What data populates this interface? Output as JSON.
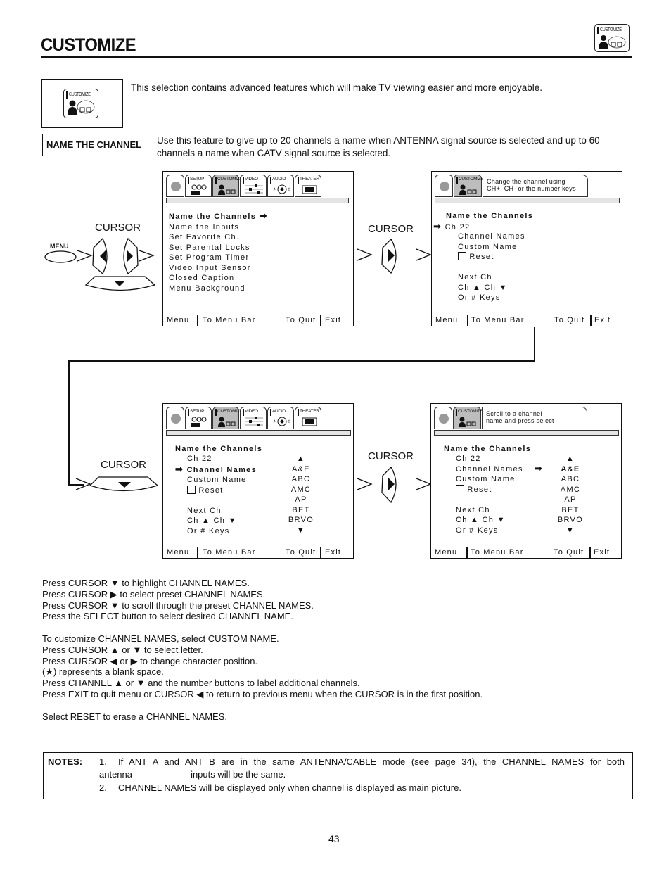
{
  "header": {
    "title": "CUSTOMIZE",
    "icon_label": "CUSTOMIZE"
  },
  "intro": {
    "icon_label": "CUSTOMIZE",
    "text": "This selection contains advanced features which will make TV viewing easier and more enjoyable."
  },
  "feature": {
    "label": "NAME THE CHANNEL",
    "text": "Use this feature to give up to 20 channels a name when ANTENNA signal source is selected and up to 60 channels a name when CATV signal source is selected."
  },
  "controls": {
    "menu_label": "MENU",
    "cursor_label": "CURSOR"
  },
  "menu_tabs": [
    "SETUP",
    "CUSTOMIZE",
    "VIDEO",
    "AUDIO",
    "THEATER"
  ],
  "footer": {
    "menu": "Menu",
    "to_menu_bar": "To Menu Bar",
    "to_quit": "To Quit",
    "exit": "Exit"
  },
  "screen1": {
    "items": [
      "Name the Channels",
      "Name the Inputs",
      "Set Favorite Ch.",
      "Set Parental Locks",
      "Set Program Timer",
      "Video Input Sensor",
      "Closed Caption",
      "Menu Background"
    ]
  },
  "screen2": {
    "help": [
      "Change the channel using",
      "CH+, CH- or the number keys"
    ],
    "title": "Name the Channels",
    "items": [
      "Ch 22",
      "Channel Names",
      "Custom Name",
      "Reset",
      "Next Ch",
      "Ch ▲ Ch ▼",
      "Or # Keys"
    ]
  },
  "screen3": {
    "title": "Name the Channels",
    "items": [
      "Ch 22",
      "Channel Names",
      "Custom Name",
      "Reset",
      "Next Ch",
      "Ch ▲ Ch ▼",
      "Or # Keys"
    ],
    "names": [
      "▲",
      "A&E",
      "ABC",
      "AMC",
      "AP",
      "BET",
      "BRVO",
      "▼"
    ]
  },
  "screen4": {
    "help": [
      "Scroll to a channel",
      "name and press select"
    ],
    "title": "Name the Channels",
    "items": [
      "Ch 22",
      "Channel Names",
      "Custom Name",
      "Reset",
      "Next Ch",
      "Ch ▲ Ch ▼",
      "Or # Keys"
    ],
    "names": [
      "▲",
      "A&E",
      "ABC",
      "AMC",
      "AP",
      "BET",
      "BRVO",
      "▼"
    ]
  },
  "instructions": [
    "Press CURSOR  ▼ to highlight CHANNEL NAMES.",
    "Press CURSOR ▶ to select preset CHANNEL NAMES.",
    "Press CURSOR ▼ to scroll through the preset CHANNEL NAMES.",
    "Press the SELECT button to select desired CHANNEL NAME.",
    "",
    "To customize CHANNEL NAMES, select CUSTOM NAME.",
    "Press CURSOR ▲ or ▼ to select letter.",
    "Press CURSOR ◀ or ▶ to change character position.",
    "(★) represents a blank space.",
    "Press CHANNEL ▲ or ▼  and the number buttons to label additional channels.",
    "Press EXIT to quit menu or CURSOR ◀ to return to previous menu when the CURSOR is in the first position.",
    "",
    "Select RESET to erase a CHANNEL NAMES."
  ],
  "notes": {
    "label": "NOTES:",
    "items": [
      {
        "num": "1.",
        "text": "If ANT A and ANT B are in the same ANTENNA/CABLE mode (see page 34), the CHANNEL NAMES for both",
        "cont": "antenna                       inputs will be the same."
      },
      {
        "num": "2.",
        "text": "CHANNEL NAMES will be displayed only when channel is displayed as main picture.",
        "cont": ""
      }
    ]
  },
  "page_number": "43"
}
